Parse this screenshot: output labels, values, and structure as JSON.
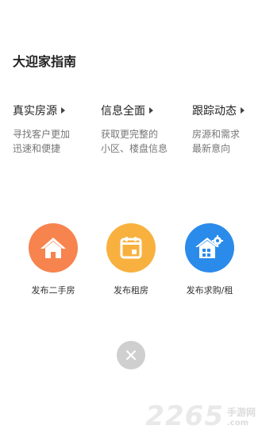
{
  "guide": {
    "title": "大迎家指南"
  },
  "features": [
    {
      "heading": "真实房源",
      "desc_line1": "寻找客户更加",
      "desc_line2": "迅速和便捷"
    },
    {
      "heading": "信息全面",
      "desc_line1": "获取更完整的",
      "desc_line2": "小区、楼盘信息"
    },
    {
      "heading": "跟踪动态",
      "desc_line1": "房源和需求",
      "desc_line2": "最新意向"
    }
  ],
  "actions": [
    {
      "label": "发布二手房",
      "icon": "house-icon",
      "color": "#F7834E"
    },
    {
      "label": "发布租房",
      "icon": "calendar-icon",
      "color": "#F8B13F"
    },
    {
      "label": "发布求购/租",
      "icon": "building-gear-icon",
      "color": "#2B8BEA"
    }
  ],
  "close": {
    "icon": "close-icon"
  },
  "watermark": {
    "number": "2265",
    "text_line1": "手游网",
    "text_line2": ".com"
  }
}
